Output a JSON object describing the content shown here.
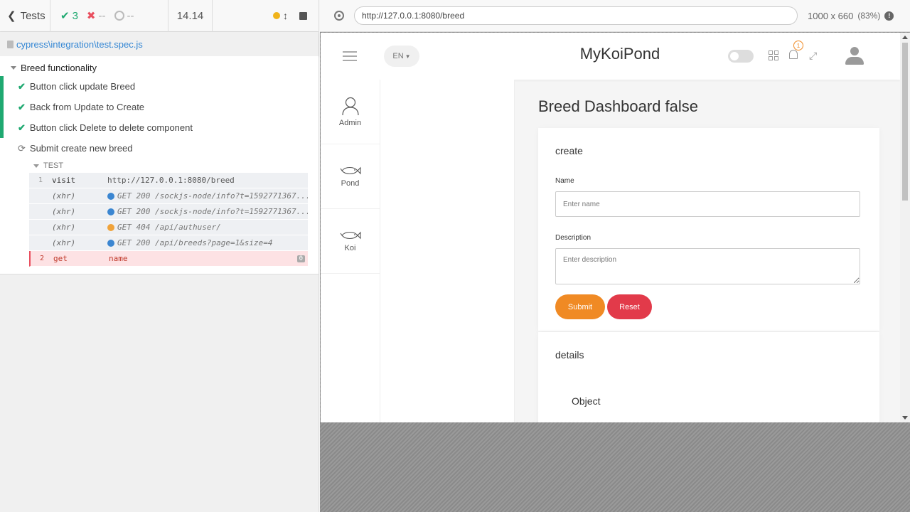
{
  "reporter": {
    "tests_label": "Tests",
    "passed": "3",
    "failed": "--",
    "pending": "--",
    "duration": "14.14",
    "spec_path": "cypress\\integration\\test.spec.js",
    "suite": "Breed functionality",
    "tests": [
      {
        "label": "Button click update Breed",
        "state": "passed"
      },
      {
        "label": "Back from Update to Create",
        "state": "passed"
      },
      {
        "label": "Button click Delete to delete component",
        "state": "passed"
      },
      {
        "label": "Submit create new breed",
        "state": "running"
      }
    ],
    "hook_label": "TEST",
    "commands": [
      {
        "num": "1",
        "name": "visit",
        "message": "http://127.0.0.1:8080/breed",
        "type": "cmd"
      },
      {
        "num": "",
        "name": "(xhr)",
        "message": "GET 200 /sockjs-node/info?t=1592771367...",
        "type": "xhr",
        "dot_color": "#3b86d1"
      },
      {
        "num": "",
        "name": "(xhr)",
        "message": "GET 200 /sockjs-node/info?t=1592771367...",
        "type": "xhr",
        "dot_color": "#3b86d1"
      },
      {
        "num": "",
        "name": "(xhr)",
        "message": "GET 404 /api/authuser/",
        "type": "xhr",
        "dot_color": "#f0a33a"
      },
      {
        "num": "",
        "name": "(xhr)",
        "message": "GET 200 /api/breeds?page=1&size=4",
        "type": "xhr",
        "dot_color": "#3b86d1"
      },
      {
        "num": "2",
        "name": "get",
        "message": "name",
        "type": "failed",
        "badge": "0"
      }
    ]
  },
  "aut": {
    "url": "http://127.0.0.1:8080/breed",
    "viewport": "1000 x 660",
    "zoom": "(83%)"
  },
  "app": {
    "brand": "MyKoiPond",
    "lang": "EN",
    "notification_count": "1",
    "sidebar": [
      {
        "label": "Admin",
        "icon": "user-outline-icon"
      },
      {
        "label": "Pond",
        "icon": "fish-icon"
      },
      {
        "label": "Koi",
        "icon": "fish-icon"
      }
    ],
    "page_title": "Breed Dashboard false",
    "create_card": {
      "title": "create",
      "name_label": "Name",
      "name_placeholder": "Enter name",
      "description_label": "Description",
      "description_placeholder": "Enter description",
      "submit": "Submit",
      "reset": "Reset"
    },
    "details_card": {
      "title": "details",
      "object": "Object"
    }
  }
}
